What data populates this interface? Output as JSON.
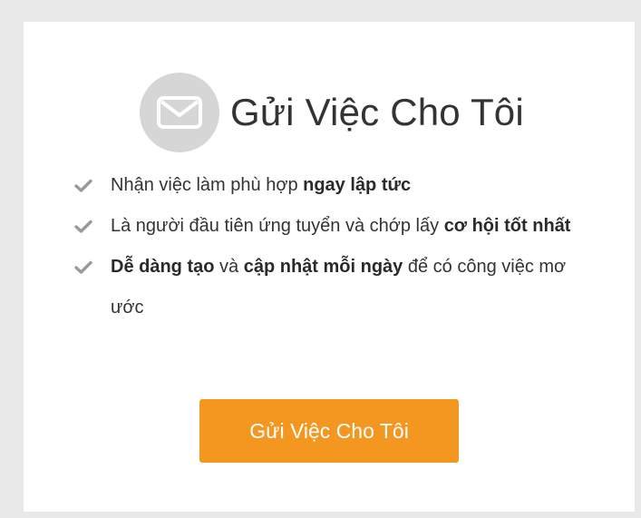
{
  "header": {
    "title": "Gửi Việc Cho Tôi",
    "icon": "envelope-icon"
  },
  "benefits": [
    {
      "pre": "Nhận việc làm phù hợp ",
      "bold1": "ngay lập tức",
      "mid": "",
      "bold2": "",
      "post": ""
    },
    {
      "pre": "Là người đầu tiên ứng tuyển và chớp lấy ",
      "bold1": "cơ hội tốt nhất",
      "mid": "",
      "bold2": "",
      "post": ""
    },
    {
      "pre": "",
      "bold1": "Dễ dàng tạo",
      "mid": " và ",
      "bold2": "cập nhật mỗi ngày",
      "post": " để có công việc mơ ước"
    }
  ],
  "cta": {
    "label": "Gửi Việc Cho Tôi"
  },
  "colors": {
    "accent": "#f39720",
    "icon_circle": "#d6d6d6",
    "check": "#9a9a9a",
    "background": "#e9e9e9"
  }
}
